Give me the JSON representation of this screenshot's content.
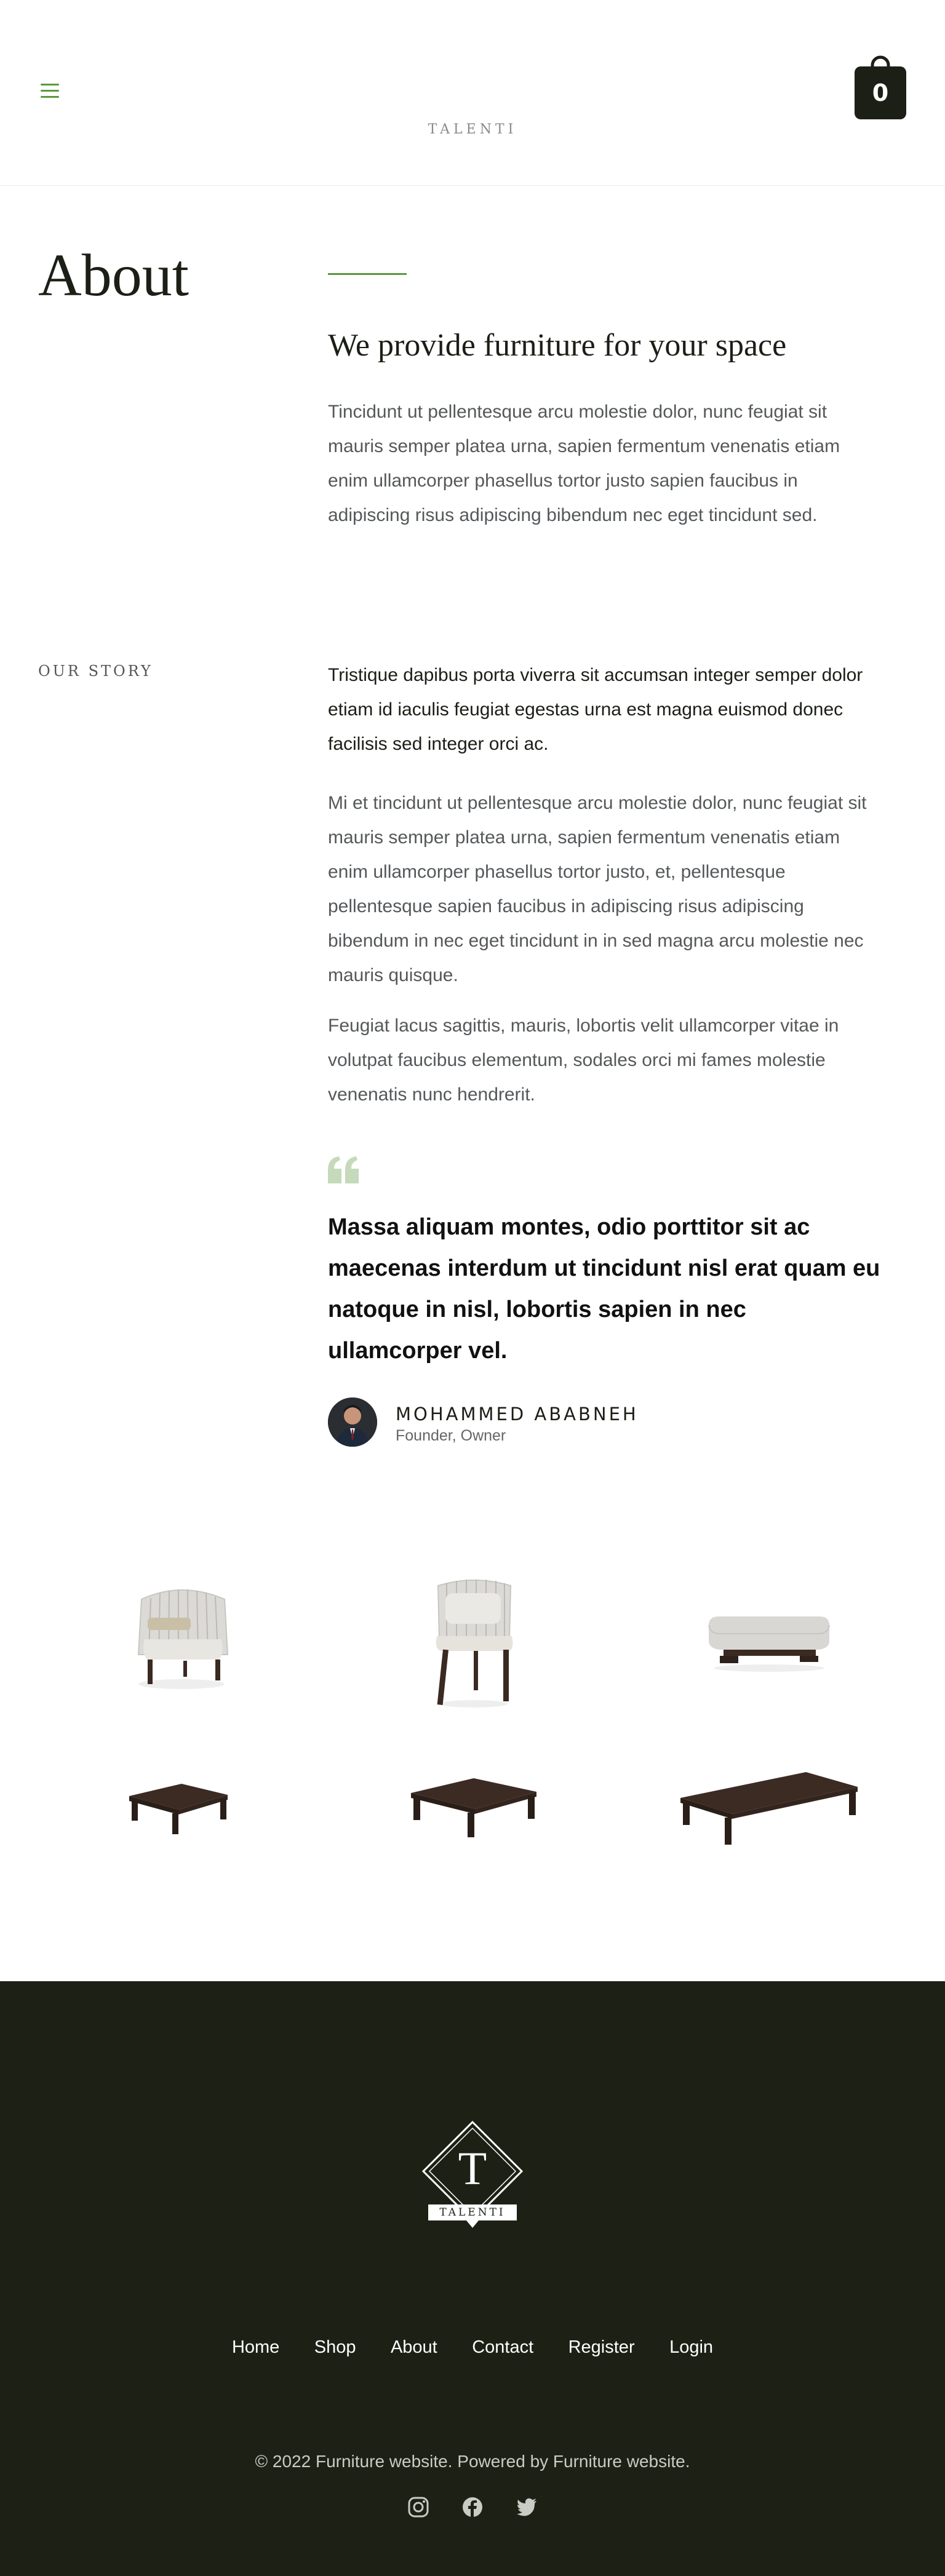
{
  "header": {
    "site_title": "TALENTI",
    "cart_count": "0"
  },
  "about": {
    "title": "About",
    "heading": "We provide furniture for your space",
    "text": "Tincidunt ut pellentesque arcu molestie dolor, nunc feugiat sit mauris semper platea urna, sapien fermentum venenatis etiam enim ullamcorper phasellus tortor justo sapien faucibus in adipiscing risus adipiscing bibendum nec eget tincidunt sed."
  },
  "story": {
    "label": "OUR STORY",
    "lead": "Tristique dapibus porta viverra sit accumsan integer semper dolor etiam id iaculis feugiat egestas urna est magna euismod donec facilisis sed integer orci ac.",
    "paragraph_1": "Mi et tincidunt ut pellentesque arcu molestie dolor, nunc feugiat sit mauris semper platea urna, sapien fermentum venenatis etiam enim ullamcorper phasellus tortor justo, et, pellentesque pellentesque sapien faucibus in adipiscing risus adipiscing bibendum in nec eget tincidunt in in sed magna arcu molestie nec mauris quisque.",
    "paragraph_2": "Feugiat lacus sagittis, mauris, lobortis velit ullamcorper vitae in volutpat faucibus elementum, sodales orci mi fames molestie venenatis nunc hendrerit.",
    "quote": "Massa aliquam montes, odio porttitor sit ac maecenas interdum ut tincidunt nisl erat quam eu natoque in nisl, lobortis sapien in nec ullamcorper vel.",
    "author_name": "MOHAMMED ABABNEH",
    "author_role": "Founder, Owner"
  },
  "products": [
    {
      "name": "lounge-armchair"
    },
    {
      "name": "dining-chair"
    },
    {
      "name": "ottoman"
    },
    {
      "name": "small-coffee-table"
    },
    {
      "name": "square-coffee-table"
    },
    {
      "name": "long-coffee-table"
    }
  ],
  "footer": {
    "logo_letter": "T",
    "logo_text": "TALENTI",
    "nav": [
      "Home",
      "Shop",
      "About",
      "Contact",
      "Register",
      "Login"
    ],
    "copyright": "© 2022 Furniture website. Powered by Furniture website.",
    "social_icons": [
      "instagram-icon",
      "facebook-icon",
      "twitter-icon"
    ]
  },
  "colors": {
    "accent": "#5a9a3c",
    "dark": "#1b1f16",
    "footer_bg": "#1d2115",
    "quote_icon": "#c5d9bb"
  }
}
